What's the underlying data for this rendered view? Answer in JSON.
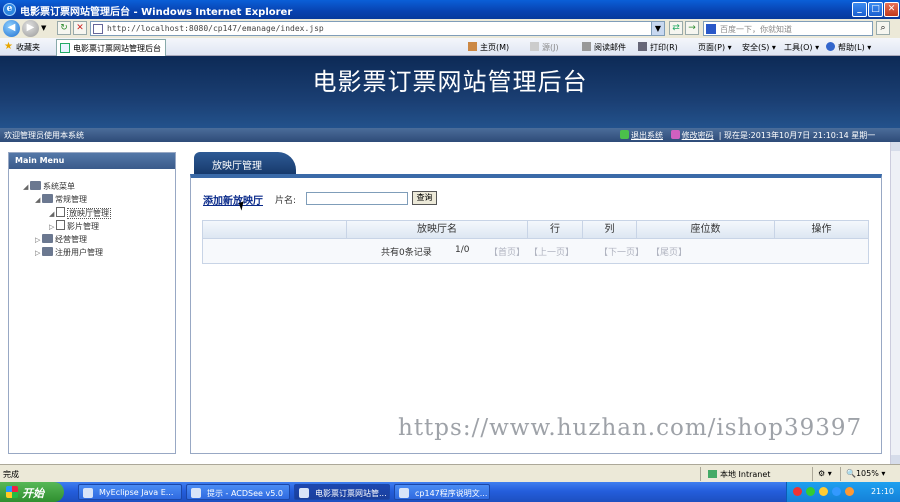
{
  "browser": {
    "window_title": "电影票订票网站管理后台 - Windows Internet Explorer",
    "url": "http://localhost:8080/cp147/emanage/index.jsp",
    "search_placeholder": "百度一下，你就知道",
    "favorites_label": "收藏夹",
    "tab_label": "电影票订票网站管理后台",
    "commands": {
      "home": "主页(M)",
      "feeds": "源(J)",
      "read_mail": "阅读邮件",
      "print": "打印(R)",
      "page": "页面(P)",
      "safety": "安全(S)",
      "tools": "工具(O)",
      "help": "帮助(L)"
    }
  },
  "app": {
    "title": "电影票订票网站管理后台",
    "welcome": "欢迎管理员使用本系统",
    "logout_label": "退出系统",
    "change_password_label": "修改密码",
    "datetime": "现在是:2013年10月7日  21:10:14 星期一"
  },
  "sidebar": {
    "header": "Main Menu",
    "tree": [
      {
        "label": "系统菜单",
        "level": 0,
        "type": "folder",
        "expanded": true
      },
      {
        "label": "常规管理",
        "level": 1,
        "type": "folder",
        "expanded": true
      },
      {
        "label": "放映厅管理",
        "level": 2,
        "type": "doc",
        "selected": true
      },
      {
        "label": "影片管理",
        "level": 2,
        "type": "doc"
      },
      {
        "label": "经营管理",
        "level": 1,
        "type": "folder"
      },
      {
        "label": "注册用户管理",
        "level": 1,
        "type": "folder"
      }
    ]
  },
  "main": {
    "tab_label": "放映厅管理",
    "add_link": "添加新放映厅",
    "name_label": "片名:",
    "name_value": "",
    "query_button": "查询",
    "columns": [
      "放映厅名",
      "行",
      "列",
      "座位数",
      "操作"
    ],
    "pagination": {
      "total_text": "共有0条记录",
      "page_text": "1/0",
      "first": "【首页】",
      "prev": "【上一页】",
      "next": "【下一页】",
      "last": "【尾页】"
    }
  },
  "watermark": "https://www.huzhan.com/ishop39397",
  "statusbar": {
    "status": "完成",
    "zone": "本地 Intranet",
    "zoom": "105%"
  },
  "taskbar": {
    "start": "开始",
    "tasks": [
      "MyEclipse Java E...",
      "提示 - ACDSee v5.0",
      "电影票订票网站管...",
      "cp147程序说明文..."
    ],
    "clock": "21:10"
  },
  "colors": {
    "header_bg": "#1a3e72",
    "accent": "#3a6aa8",
    "link": "#0a2a8a"
  }
}
